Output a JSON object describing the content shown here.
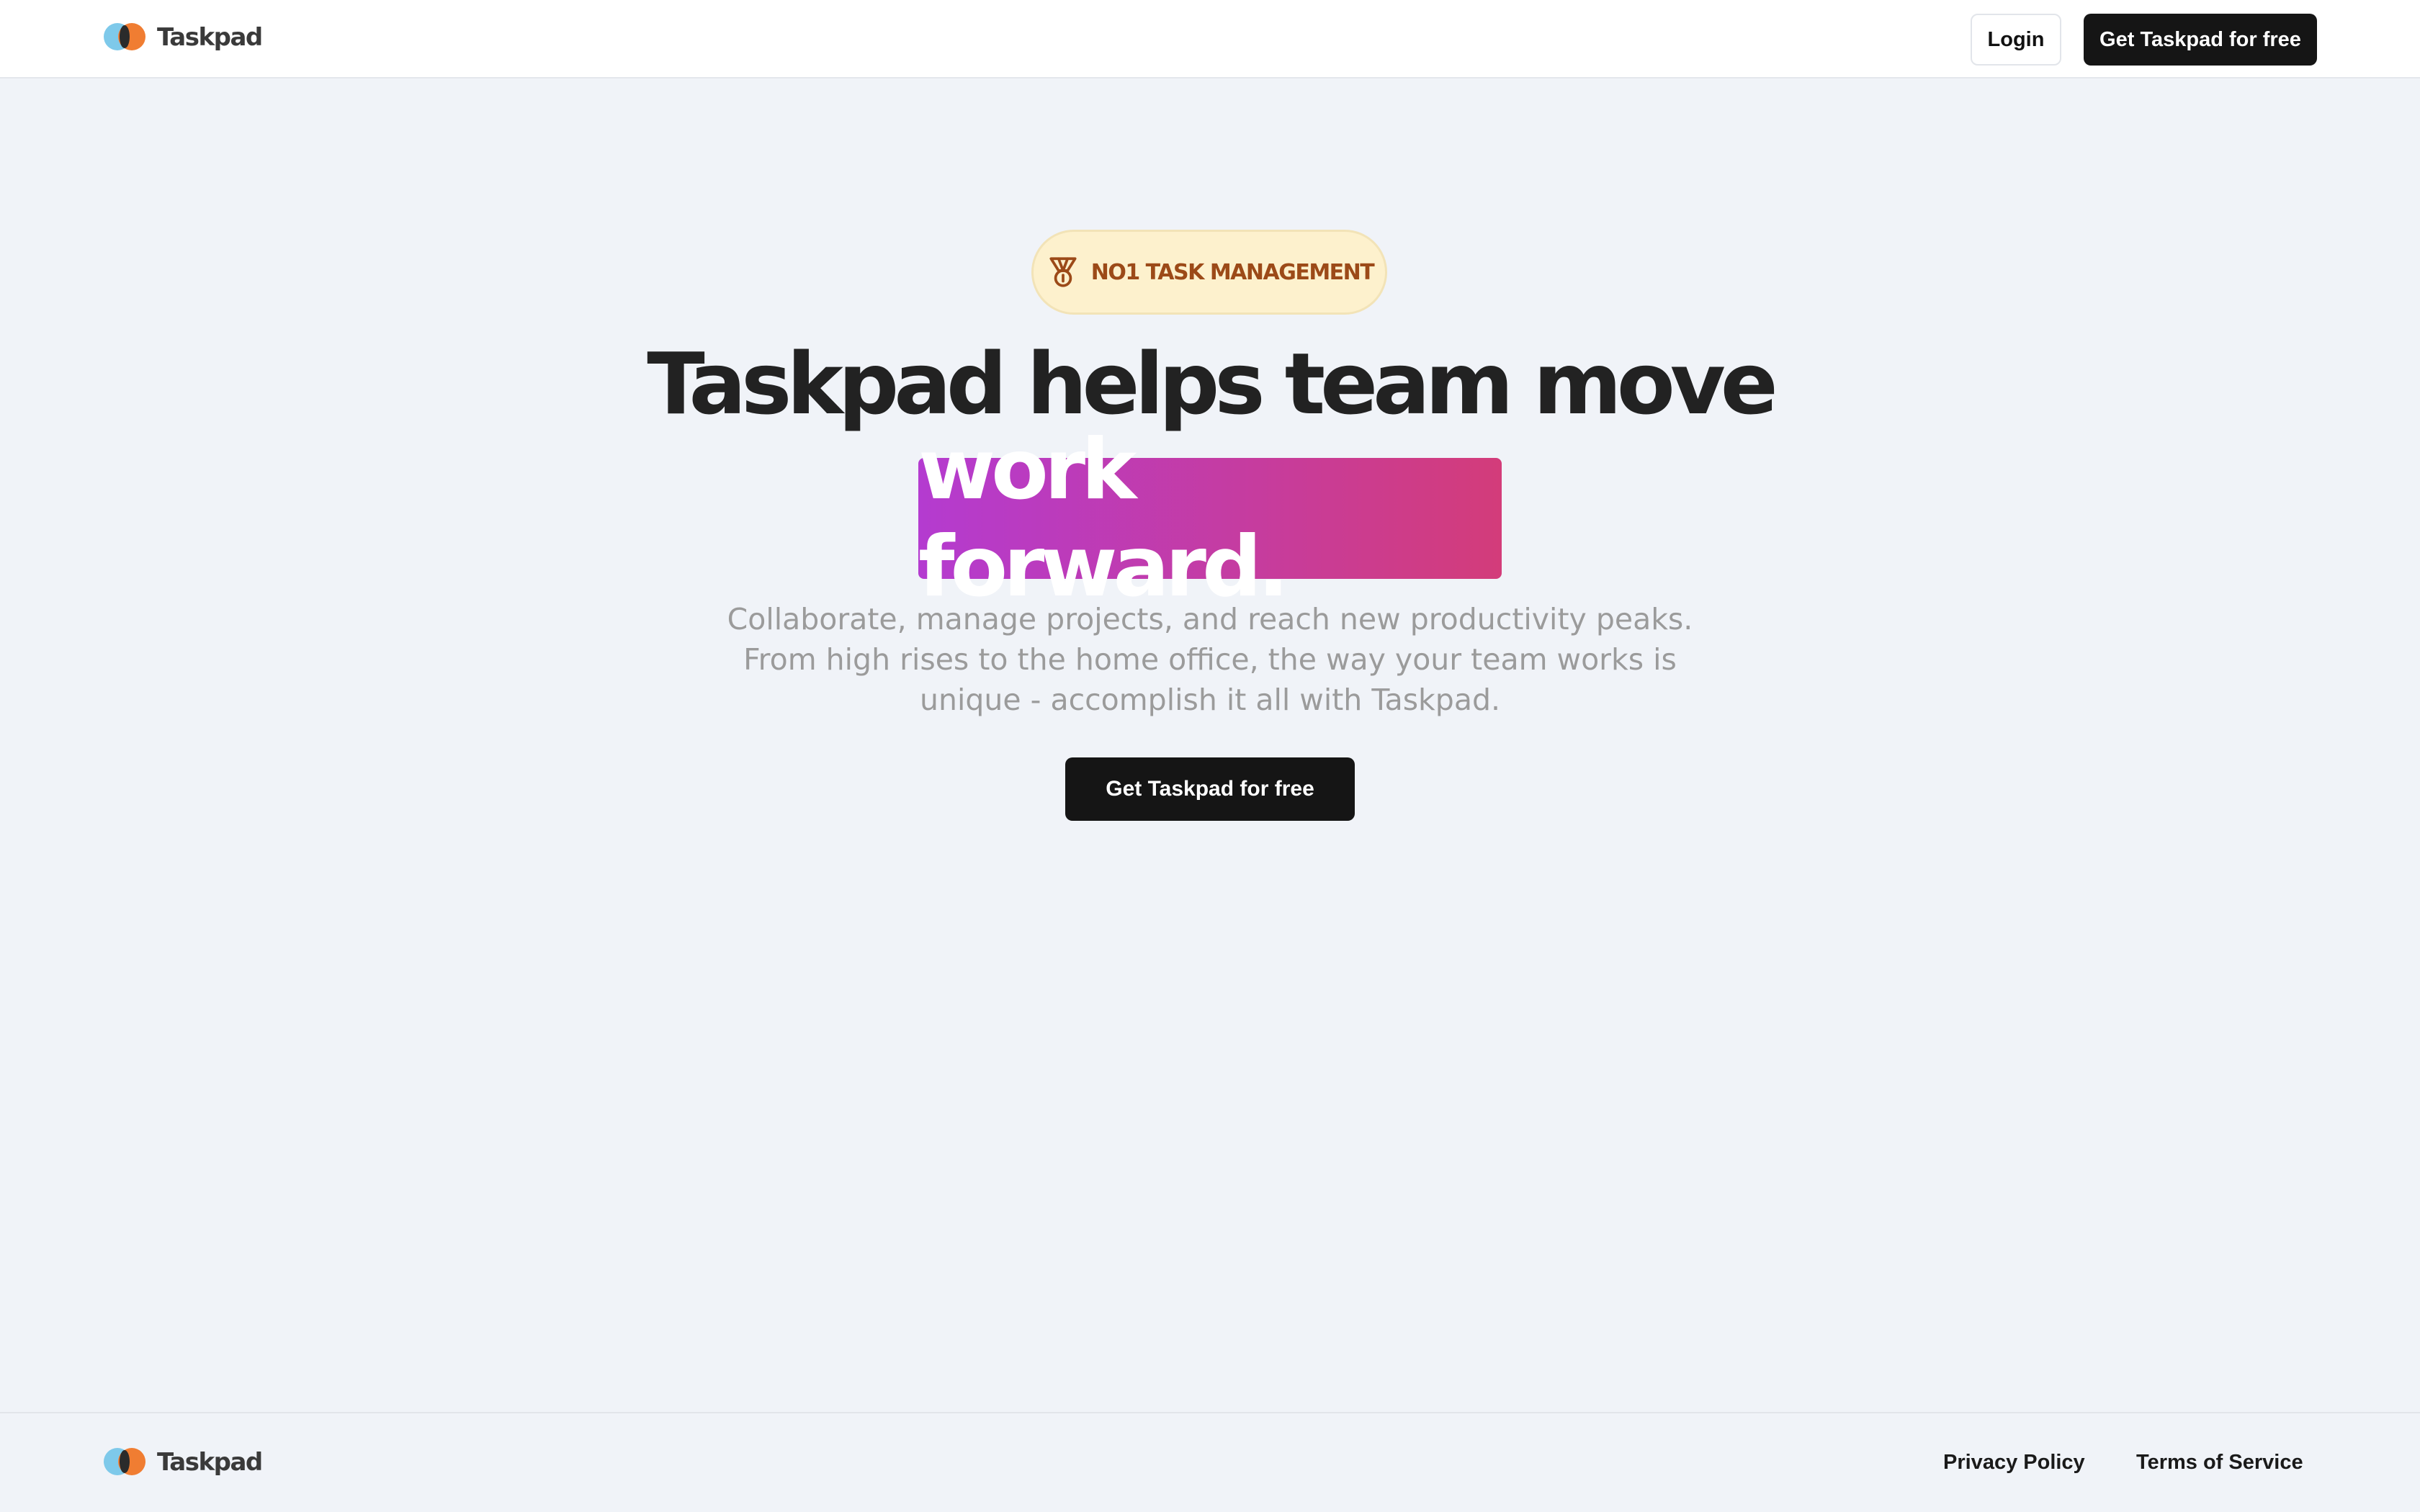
{
  "brand": {
    "name": "Taskpad",
    "logo_icon": "taskpad-logo-icon",
    "colors": {
      "left": "#7ec9ea",
      "right": "#f07d32",
      "center": "#2b2b2b"
    }
  },
  "header": {
    "login_label": "Login",
    "cta_label": "Get Taskpad for free"
  },
  "hero": {
    "badge": {
      "icon": "medal-icon",
      "text": "NO1 TASK MANAGEMENT"
    },
    "headline": "Taskpad helps team move",
    "highlight": "work forward.",
    "subtext_lines": [
      "Collaborate, manage projects, and reach new productivity peaks.",
      "From high rises to the home office, the way your team works is",
      "unique - accomplish it all with Taskpad."
    ],
    "cta_label": "Get Taskpad for free"
  },
  "footer": {
    "links": {
      "privacy": "Privacy Policy",
      "terms": "Terms of Service"
    }
  },
  "colors": {
    "background": "#f0f3f8",
    "primary_button": "#151515",
    "badge_bg": "#fdf1cd",
    "badge_text": "#9c4a18",
    "gradient_start": "#b43bd0",
    "gradient_end": "#d33c7a"
  }
}
